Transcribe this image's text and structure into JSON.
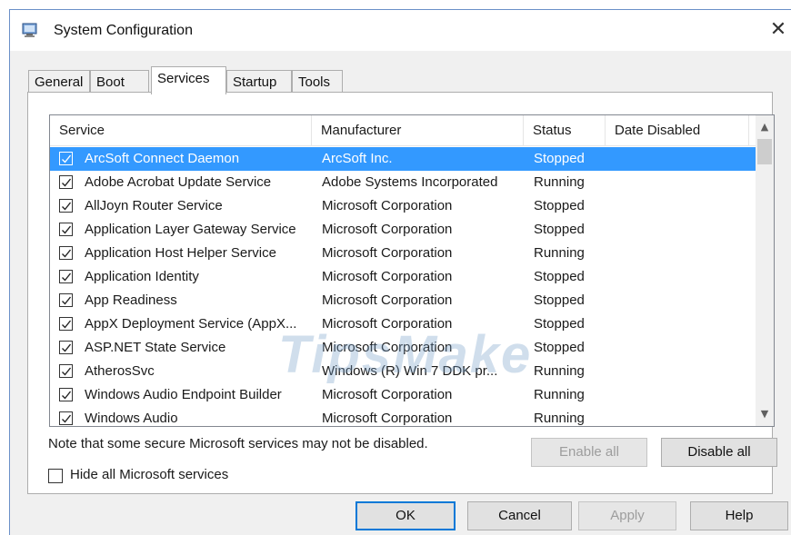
{
  "window": {
    "title": "System Configuration",
    "close_symbol": "✕"
  },
  "tabs": [
    {
      "label": "General"
    },
    {
      "label": "Boot"
    },
    {
      "label": "Services",
      "active": true
    },
    {
      "label": "Startup"
    },
    {
      "label": "Tools"
    }
  ],
  "services": {
    "columns": [
      "Service",
      "Manufacturer",
      "Status",
      "Date Disabled"
    ],
    "rows": [
      {
        "checked": true,
        "service": "ArcSoft Connect Daemon",
        "manufacturer": "ArcSoft Inc.",
        "status": "Stopped",
        "date_disabled": "",
        "selected": true
      },
      {
        "checked": true,
        "service": "Adobe Acrobat Update Service",
        "manufacturer": "Adobe Systems Incorporated",
        "status": "Running",
        "date_disabled": ""
      },
      {
        "checked": true,
        "service": "AllJoyn Router Service",
        "manufacturer": "Microsoft Corporation",
        "status": "Stopped",
        "date_disabled": ""
      },
      {
        "checked": true,
        "service": "Application Layer Gateway Service",
        "manufacturer": "Microsoft Corporation",
        "status": "Stopped",
        "date_disabled": ""
      },
      {
        "checked": true,
        "service": "Application Host Helper Service",
        "manufacturer": "Microsoft Corporation",
        "status": "Running",
        "date_disabled": ""
      },
      {
        "checked": true,
        "service": "Application Identity",
        "manufacturer": "Microsoft Corporation",
        "status": "Stopped",
        "date_disabled": ""
      },
      {
        "checked": true,
        "service": "App Readiness",
        "manufacturer": "Microsoft Corporation",
        "status": "Stopped",
        "date_disabled": ""
      },
      {
        "checked": true,
        "service": "AppX Deployment Service (AppX...",
        "manufacturer": "Microsoft Corporation",
        "status": "Stopped",
        "date_disabled": ""
      },
      {
        "checked": true,
        "service": "ASP.NET State Service",
        "manufacturer": "Microsoft Corporation",
        "status": "Stopped",
        "date_disabled": ""
      },
      {
        "checked": true,
        "service": "AtherosSvc",
        "manufacturer": "Windows (R) Win 7 DDK pr...",
        "status": "Running",
        "date_disabled": ""
      },
      {
        "checked": true,
        "service": "Windows Audio Endpoint Builder",
        "manufacturer": "Microsoft Corporation",
        "status": "Running",
        "date_disabled": ""
      },
      {
        "checked": true,
        "service": "Windows Audio",
        "manufacturer": "Microsoft Corporation",
        "status": "Running",
        "date_disabled": ""
      }
    ]
  },
  "note": "Note that some secure Microsoft services may not be disabled.",
  "enable_all_label": "Enable all",
  "disable_all_label": "Disable all",
  "hide_ms_label": "Hide all Microsoft services",
  "hide_ms_checked": false,
  "footer": {
    "ok_label": "OK",
    "cancel_label": "Cancel",
    "apply_label": "Apply",
    "help_label": "Help"
  },
  "watermark_text": "TipsMake",
  "colors": {
    "selection": "#3399ff",
    "window_border": "#6b90c8"
  }
}
